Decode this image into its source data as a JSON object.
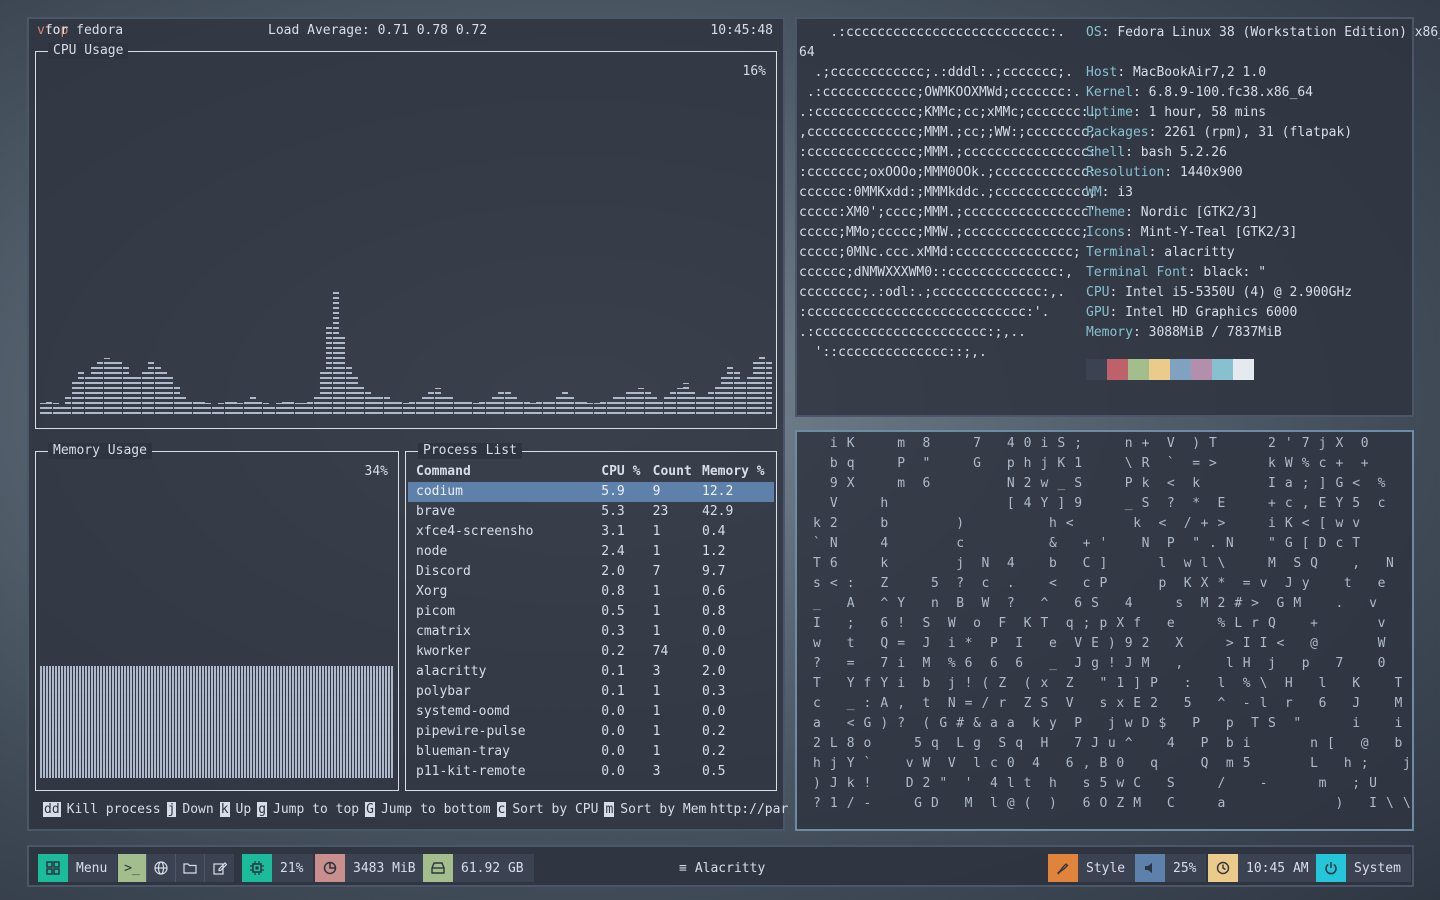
{
  "vtop": {
    "app": "vtop",
    "for_text": "for fedora",
    "load_average": "Load Average: 0.71 0.78 0.72",
    "clock": "10:45:48",
    "cpu": {
      "title": "CPU Usage",
      "percent": "16%"
    },
    "memory": {
      "title": "Memory Usage",
      "percent": "34%"
    },
    "process_list": {
      "title": "Process List",
      "columns": [
        "Command",
        "CPU %",
        "Count",
        "Memory %"
      ],
      "rows": [
        [
          "codium",
          "5.9",
          "9",
          "12.2"
        ],
        [
          "brave",
          "5.3",
          "23",
          "42.9"
        ],
        [
          "xfce4-screensho",
          "3.1",
          "1",
          "0.4"
        ],
        [
          "node",
          "2.4",
          "1",
          "1.2"
        ],
        [
          "Discord",
          "2.0",
          "7",
          "9.7"
        ],
        [
          "Xorg",
          "0.8",
          "1",
          "0.6"
        ],
        [
          "picom",
          "0.5",
          "1",
          "0.8"
        ],
        [
          "cmatrix",
          "0.3",
          "1",
          "0.0"
        ],
        [
          "kworker",
          "0.2",
          "74",
          "0.0"
        ],
        [
          "alacritty",
          "0.1",
          "3",
          "2.0"
        ],
        [
          "polybar",
          "0.1",
          "1",
          "0.3"
        ],
        [
          "systemd-oomd",
          "0.0",
          "1",
          "0.0"
        ],
        [
          "pipewire-pulse",
          "0.0",
          "1",
          "0.2"
        ],
        [
          "blueman-tray",
          "0.0",
          "1",
          "0.2"
        ],
        [
          "p11-kit-remote",
          "0.0",
          "3",
          "0.5"
        ]
      ]
    },
    "footer": [
      {
        "key": "dd",
        "label": "Kill process"
      },
      {
        "key": "j",
        "label": "Down"
      },
      {
        "key": "k",
        "label": "Up"
      },
      {
        "key": "g",
        "label": "Jump to top"
      },
      {
        "key": "G",
        "label": "Jump to bottom"
      },
      {
        "key": "c",
        "label": "Sort by CPU"
      },
      {
        "key": "m",
        "label": "Sort by Mem"
      }
    ],
    "footer_url": "http://par"
  },
  "neofetch": {
    "logo": [
      "    .:cccccccccccccccccccccccccc:.",
      "64",
      "  .;cccccccccccc;.:dddl:.;ccccccc;.",
      " .:cccccccccccc;OWMKOOXMWd;ccccccc:.",
      ".:ccccccccccccc;KMMc;cc;xMMc;ccccccc:.",
      ",cccccccccccccc;MMM.;cc;;WW:;cccccccc,",
      ":cccccccccccccc;MMM.;cccccccccccccccc:",
      ":ccccccc;oxOOOo;MMM0OOk.;cccccccccccc:",
      "cccccc:0MMKxdd:;MMMkddc.;cccccccccccc;",
      "ccccc:XM0';cccc;MMM.;cccccccccccccccc'",
      "ccccc;MMo;ccccc;MMW.;ccccccccccccccc;",
      "ccccc;0MNc.ccc.xMMd:ccccccccccccccc;",
      "cccccc;dNMWXXXWM0::cccccccccccccc:,",
      "cccccccc;.:odl:.;cccccccccccccc:,.",
      ":cccccccccccccccccccccccccccc:'.",
      ".:cccccccccccccccccccccc:;,..",
      "  '::cccccccccccccc::;,."
    ],
    "info": [
      {
        "label": "OS",
        "value": "Fedora Linux 38 (Workstation Edition) x86_"
      },
      {
        "label": "",
        "value": ""
      },
      {
        "label": "Host",
        "value": "MacBookAir7,2 1.0"
      },
      {
        "label": "Kernel",
        "value": "6.8.9-100.fc38.x86_64"
      },
      {
        "label": "Uptime",
        "value": "1 hour, 58 mins"
      },
      {
        "label": "Packages",
        "value": "2261 (rpm), 31 (flatpak)"
      },
      {
        "label": "Shell",
        "value": "bash 5.2.26"
      },
      {
        "label": "Resolution",
        "value": "1440x900"
      },
      {
        "label": "WM",
        "value": "i3"
      },
      {
        "label": "Theme",
        "value": "Nordic [GTK2/3]"
      },
      {
        "label": "Icons",
        "value": "Mint-Y-Teal [GTK2/3]"
      },
      {
        "label": "Terminal",
        "value": "alacritty"
      },
      {
        "label": "Terminal Font",
        "value": "black: \""
      },
      {
        "label": "CPU",
        "value": "Intel i5-5350U (4) @ 2.900GHz"
      },
      {
        "label": "GPU",
        "value": "Intel HD Graphics 6000"
      },
      {
        "label": "Memory",
        "value": "3088MiB / 7837MiB"
      }
    ],
    "palette": [
      "#3b4252",
      "#bf616a",
      "#a3be8c",
      "#ebcb8b",
      "#81a1c1",
      "#b48ead",
      "#88c0d0",
      "#e5e9f0"
    ]
  },
  "cmatrix": {
    "lines": [
      "  i K     m  8     7   4 0 i S ;     n +  V  ) T      2 ' 7 j X  0",
      "  b q     P  \"     G   p h j K 1     \\ R  `  = >      k W % c +  +",
      "  9 X     m  6         N 2 w _ S     P k  <  k        I a ; ] G <  %",
      "  V     h              [ 4 Y ] 9     _ S  ?  *  E     + c , E Y 5  c",
      "k 2     b        )          h <       k  <  / + >     i K < [ w v",
      "` N     4        c          &   + '    N  P  \" . N    \" G [ D c T",
      "T 6     k        j  N  4    b   C ]      l  w l \\     M  S Q    ,   N",
      "s < :   Z     5  ?  c  .    <   c P      p  K X *  = v  J y    t   e",
      "_   A   ^ Y   n  B  W  ?   ^   6 S   4     s  M 2 # >  G M    .   v",
      "I   ;   6 !  S  W  o  F  K T  q ; p X f   e     % L r Q    +       v",
      "w   t   Q =  J  i *  P  I   e  V E ) 9 2   X     > I I <   @       W",
      "?   =   7 i  M  % 6  6  6   _  J g ! J M   ,     l H  j   p   7    0",
      "T   Y f Y i  b  j ! ( Z  ( x  Z   \" 1 ] P   :   l  % \\  H   l   K    T",
      "c   _ : A ,  t  N = / r  Z S  V   s x E 2   5   ^  - l  r   6   J    M",
      "a   < G ) ?  ( G # & a a  k y  P   j w D $   P   p  T S  \"      i    i",
      "2 L 8 o     5 q  L g  S q  H   7 J u ^    4   P  b i       n [   @   b",
      "h j Y `    v W  V  l c 0  4   6 , B 0   q     Q  m 5       L   h ;    j",
      ") J k !    D 2 \"  '  4 l t  h   s 5 w C   S     /    -      m   ; U    b",
      "? 1 / -     G D   M  l @ (  )   6 O Z M   C     a             )   I \\ \\ o"
    ]
  },
  "polybar": {
    "menu": "Menu",
    "cpu": "21%",
    "memory": "3483 MiB",
    "disk": "61.92 GB",
    "window_title": "Alacritty",
    "style": "Style",
    "volume": "25%",
    "time": "10:45 AM",
    "system": "System",
    "colors": {
      "teal": "#1abc9c",
      "green": "#a3be8c",
      "peach": "#d08770",
      "rose": "#c98e8e",
      "orange": "#e0843c",
      "blue": "#5e81ac",
      "yellow": "#ebcb8b",
      "cyan": "#26c6da"
    }
  }
}
